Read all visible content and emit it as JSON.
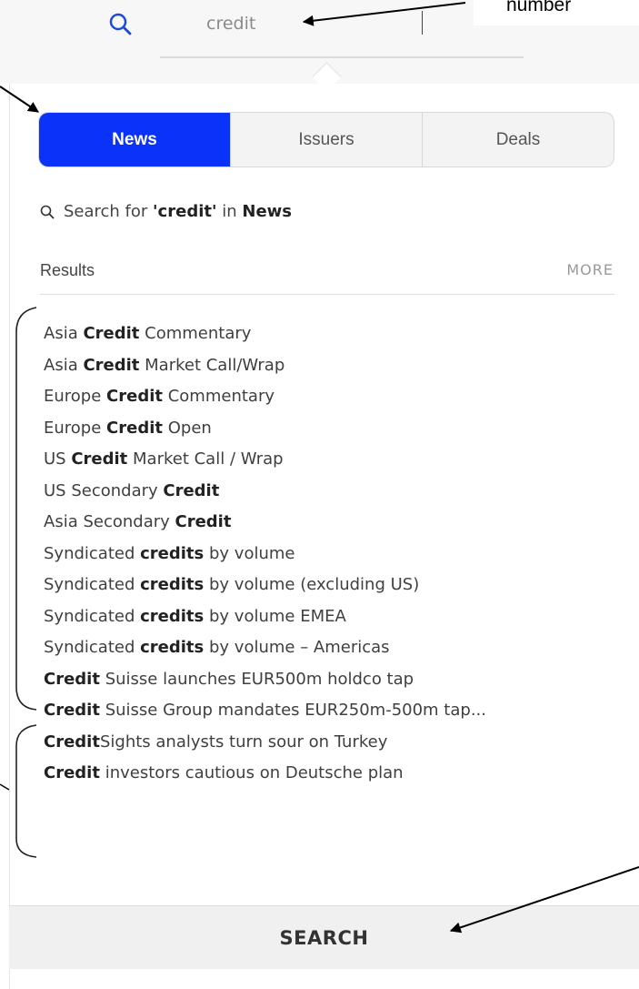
{
  "header": {
    "query": "credit",
    "annotation_note": "number"
  },
  "tabs": [
    {
      "label": "News",
      "active": true
    },
    {
      "label": "Issuers",
      "active": false
    },
    {
      "label": "Deals",
      "active": false
    }
  ],
  "search_for": {
    "prefix": "Search for",
    "query": "'credit'",
    "middle": "in",
    "scope": "News"
  },
  "results_header": {
    "label": "Results",
    "more": "MORE"
  },
  "results": [
    {
      "before": "Asia ",
      "bold": "Credit",
      "after": " Commentary"
    },
    {
      "before": "Asia ",
      "bold": "Credit",
      "after": " Market Call/Wrap"
    },
    {
      "before": "Europe ",
      "bold": "Credit",
      "after": " Commentary"
    },
    {
      "before": "Europe ",
      "bold": "Credit",
      "after": " Open"
    },
    {
      "before": "US ",
      "bold": "Credit",
      "after": " Market Call / Wrap"
    },
    {
      "before": "US Secondary ",
      "bold": "Credit",
      "after": ""
    },
    {
      "before": "Asia Secondary ",
      "bold": "Credit",
      "after": ""
    },
    {
      "before": "Syndicated ",
      "bold": "credits",
      "after": " by volume"
    },
    {
      "before": "Syndicated ",
      "bold": "credits",
      "after": " by volume (excluding US)"
    },
    {
      "before": "Syndicated ",
      "bold": "credits",
      "after": " by volume EMEA"
    },
    {
      "before": "Syndicated ",
      "bold": "credits",
      "after": " by volume – Americas"
    },
    {
      "before": "",
      "bold": "Credit",
      "after": " Suisse launches EUR500m holdco tap"
    },
    {
      "before": "",
      "bold": "Credit",
      "after": " Suisse Group mandates EUR250m-500m tap..."
    },
    {
      "before": "",
      "bold": "Credit",
      "after": "Sights analysts turn sour on Turkey"
    },
    {
      "before": "",
      "bold": "Credit",
      "after": " investors cautious on Deutsche plan"
    }
  ],
  "footer": {
    "search_button": "SEARCH"
  },
  "colors": {
    "accent": "#0a32f8",
    "icon": "#1a4cd9"
  }
}
